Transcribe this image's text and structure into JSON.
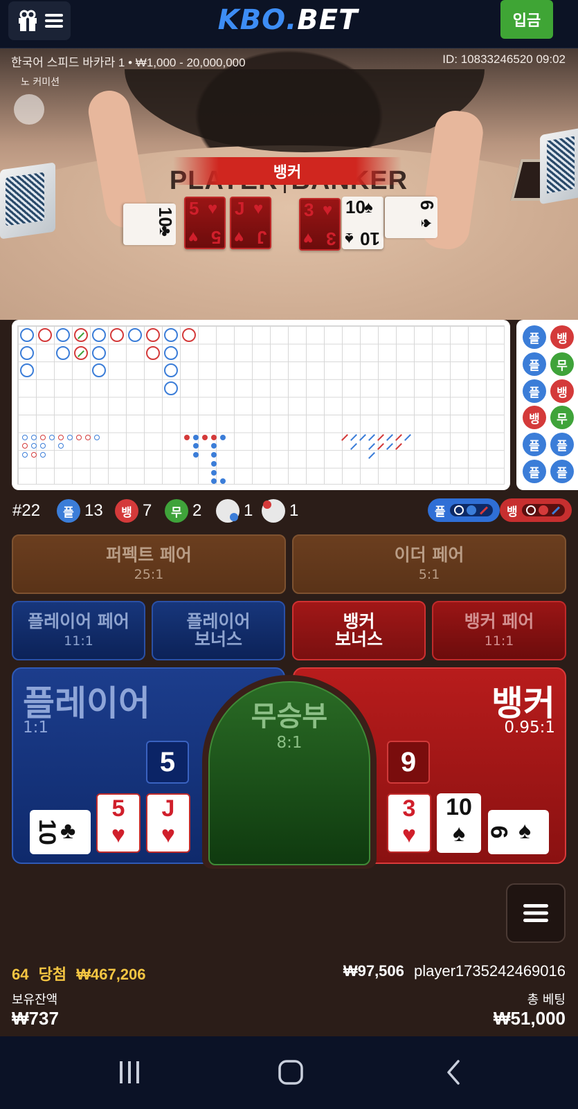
{
  "header": {
    "logo_prefix": "KBO",
    "logo_dot": ".",
    "logo_suffix": "BET",
    "deposit_label": "입금",
    "gift_icon": "gift-icon",
    "menu_icon": "hamburger-icon"
  },
  "video": {
    "game_info": "한국어 스피드 바카라 1 • ₩1,000 - 20,000,000",
    "round_id": "ID: 10833246520 09:02",
    "no_commission": "노 커미션",
    "felt_player": "PLAYER",
    "felt_banker": "BANKER",
    "winner_banner": "뱅커"
  },
  "roadmap": {
    "side_beads": [
      {
        "label": "플",
        "color": "#3b7dd8"
      },
      {
        "label": "뱅",
        "color": "#d43a3a"
      },
      {
        "label": "플",
        "color": "#3b7dd8"
      },
      {
        "label": "무",
        "color": "#3fa33a"
      },
      {
        "label": "플",
        "color": "#3b7dd8"
      },
      {
        "label": "뱅",
        "color": "#d43a3a"
      },
      {
        "label": "뱅",
        "color": "#d43a3a"
      },
      {
        "label": "무",
        "color": "#3fa33a"
      },
      {
        "label": "플",
        "color": "#3b7dd8"
      },
      {
        "label": "플",
        "color": "#3b7dd8"
      },
      {
        "label": "플",
        "color": "#3b7dd8"
      },
      {
        "label": "플",
        "color": "#3b7dd8"
      }
    ]
  },
  "stats": {
    "round": "#22",
    "player_badge": "플",
    "player_count": "13",
    "banker_badge": "뱅",
    "banker_count": "7",
    "tie_badge": "무",
    "tie_count": "2",
    "player_pair_count": "1",
    "banker_pair_count": "1",
    "player_predict": "플",
    "banker_predict": "뱅",
    "colors": {
      "player": "#3b7dd8",
      "banker": "#d43a3a",
      "tie": "#3fa33a"
    }
  },
  "bets": {
    "perfect_pair": {
      "title": "퍼펙트 페어",
      "odds": "25:1"
    },
    "either_pair": {
      "title": "이더 페어",
      "odds": "5:1"
    },
    "player_pair": {
      "title": "플레이어 페어",
      "odds": "11:1"
    },
    "player_bonus": {
      "title_line1": "플레이어",
      "title_line2": "보너스"
    },
    "banker_bonus": {
      "title_line1": "뱅커",
      "title_line2": "보너스"
    },
    "banker_pair": {
      "title": "뱅커 페어",
      "odds": "11:1"
    },
    "player": {
      "title": "플레이어",
      "odds": "1:1",
      "score": "5"
    },
    "tie": {
      "title": "무승부",
      "odds": "8:1"
    },
    "banker": {
      "title": "뱅커",
      "odds": "0.95:1",
      "score": "9"
    }
  },
  "hands": {
    "player_cards": [
      {
        "rank": "10",
        "suit": "♣",
        "color": "black",
        "side": true
      },
      {
        "rank": "5",
        "suit": "♥",
        "color": "red",
        "side": false
      },
      {
        "rank": "J",
        "suit": "♥",
        "color": "red",
        "side": false
      }
    ],
    "banker_cards": [
      {
        "rank": "3",
        "suit": "♥",
        "color": "red",
        "side": false
      },
      {
        "rank": "10",
        "suit": "♠",
        "color": "black",
        "side": false
      },
      {
        "rank": "6",
        "suit": "♠",
        "color": "black",
        "side": true
      }
    ]
  },
  "footer": {
    "win_count": "64",
    "win_label": "당첨",
    "win_amount": "₩467,206",
    "user_balance_small": "₩97,506",
    "username": "player1735242469016",
    "balance_label": "보유잔액",
    "balance_value": "₩737",
    "total_bet_label": "총 베팅",
    "total_bet_value": "₩51,000"
  }
}
